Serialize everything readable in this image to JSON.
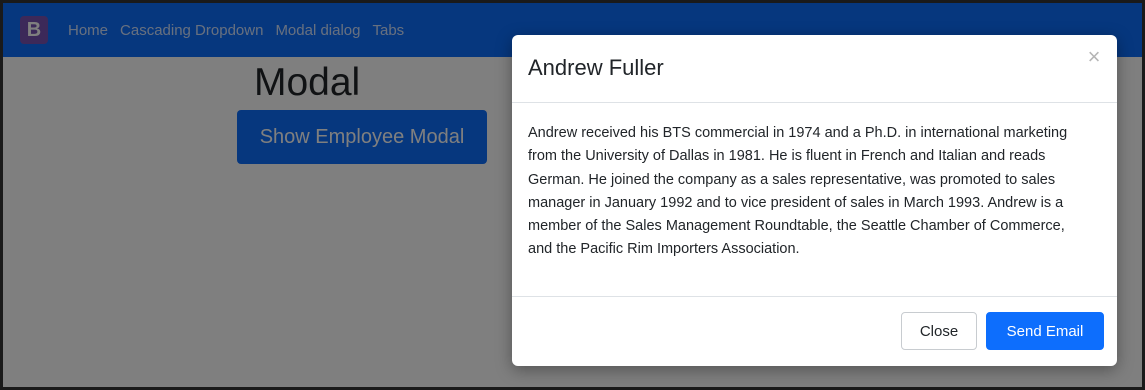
{
  "navbar": {
    "brand": "B",
    "links": [
      "Home",
      "Cascading Dropdown",
      "Modal dialog",
      "Tabs"
    ]
  },
  "page": {
    "title": "Modal",
    "show_button_label": "Show Employee Modal"
  },
  "modal": {
    "title": "Andrew Fuller",
    "close_symbol": "×",
    "body": "Andrew received his BTS commercial in 1974 and a Ph.D. in international marketing from the University of Dallas in 1981. He is fluent in French and Italian and reads German. He joined the company as a sales representative, was promoted to sales manager in January 1992 and to vice president of sales in March 1993. Andrew is a member of the Sales Management Roundtable, the Seattle Chamber of Commerce, and the Pacific Rim Importers Association.",
    "close_button_label": "Close",
    "send_button_label": "Send Email"
  },
  "colors": {
    "navbar": "#0d6efd",
    "brand": "#7952b3",
    "primary_button": "#0d6efd",
    "backdrop": "rgba(0,0,0,0.5)"
  }
}
